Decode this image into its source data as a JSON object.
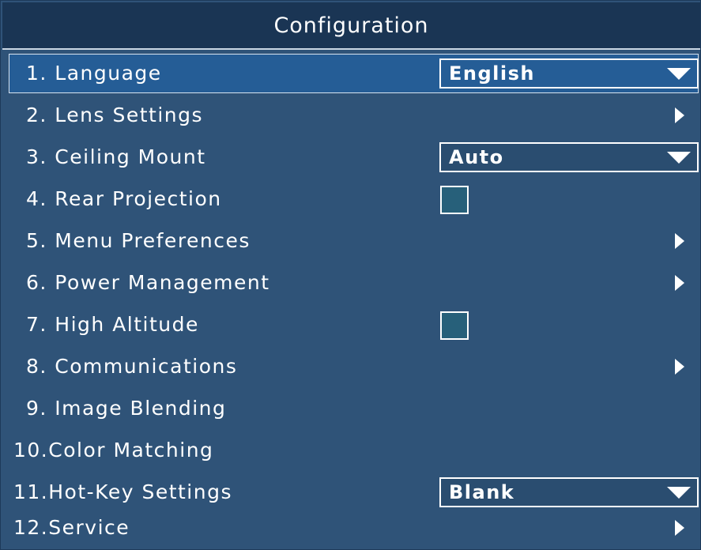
{
  "menu": {
    "title": "Configuration",
    "items": [
      {
        "label": "1. Language",
        "control": "dropdown",
        "value": "English",
        "selected": true
      },
      {
        "label": "2. Lens Settings",
        "control": "submenu"
      },
      {
        "label": "3. Ceiling Mount",
        "control": "dropdown",
        "value": "Auto"
      },
      {
        "label": "4. Rear Projection",
        "control": "checkbox",
        "checked": false
      },
      {
        "label": "5. Menu Preferences",
        "control": "submenu"
      },
      {
        "label": "6. Power Management",
        "control": "submenu"
      },
      {
        "label": "7. High Altitude",
        "control": "checkbox",
        "checked": false
      },
      {
        "label": "8. Communications",
        "control": "submenu"
      },
      {
        "label": "9. Image Blending",
        "control": "none"
      },
      {
        "label": "10.Color Matching",
        "control": "none"
      },
      {
        "label": "11.Hot-Key Settings",
        "control": "dropdown",
        "value": "Blank"
      },
      {
        "label": "12.Service",
        "control": "submenu"
      }
    ]
  },
  "colors": {
    "panel": "#2f5378",
    "title_bar": "#1a3554",
    "selection": "#255d96",
    "text": "#ffffff"
  },
  "icons": {
    "dropdown": "caret-down-icon",
    "submenu": "chevron-right-icon"
  }
}
